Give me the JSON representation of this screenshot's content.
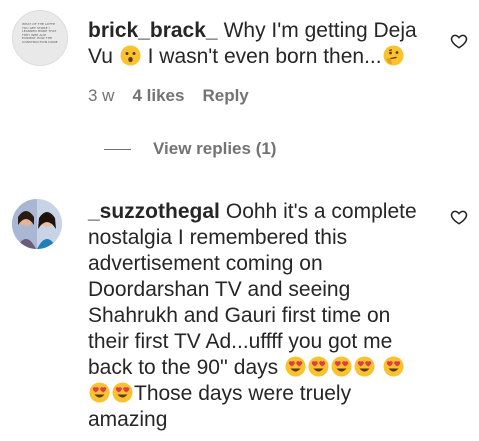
{
  "comments": [
    {
      "username": "brick_brack_",
      "text_part1": "Why I'm getting Deja Vu",
      "emoji1": "neutral-face-emoji",
      "text_part2": "I wasn't even born then...",
      "emoji2": "thinking-face-emoji",
      "time": "3 w",
      "likes": "4 likes",
      "reply_label": "Reply",
      "view_replies_label": "View replies (1)",
      "avatar_text": "WHAT OF THE LOTTE YOU GET STORE I LEARNED MORE THAT THEY WEE ALIE EVIDENT HOW THE CONSTRUCTION DONE"
    },
    {
      "username": "_suzzothegal",
      "text_part1": "Oohh it's a complete nostalgia I remembered this advertisement coming on Doordarshan TV and seeing Shahrukh and Gauri first time on their first TV Ad...uffff you got me back to the 90'' days",
      "emoji_icon": "heart-eyes-emoji",
      "text_part2": "Those days were truely amazing"
    }
  ],
  "colors": {
    "text": "#262626",
    "secondary": "#737373",
    "emoji_yellow": "#f9c22e",
    "emoji_red": "#e63946"
  }
}
